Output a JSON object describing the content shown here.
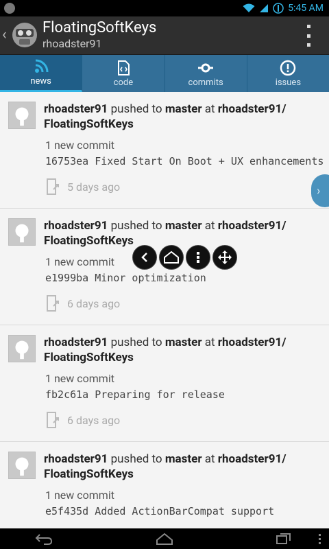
{
  "status_bar": {
    "time": "5:45 AM"
  },
  "action_bar": {
    "title": "FloatingSoftKeys",
    "subtitle": "rhoadster91"
  },
  "tabs": [
    {
      "label": "news",
      "icon": "rss-icon",
      "active": true
    },
    {
      "label": "code",
      "icon": "code-file-icon",
      "active": false
    },
    {
      "label": "commits",
      "icon": "commit-icon",
      "active": false
    },
    {
      "label": "issues",
      "icon": "issue-icon",
      "active": false
    }
  ],
  "feed": [
    {
      "user": "rhoadster91",
      "action": "pushed to",
      "branch": "master",
      "at": "at",
      "repo": "rhoadster91/",
      "repo2": "FloatingSoftKeys",
      "count": "1 new commit",
      "commit": "16753ea Fixed Start On Boot + UX enhancements",
      "time": "5 days ago"
    },
    {
      "user": "rhoadster91",
      "action": "pushed to",
      "branch": "master",
      "at": "at",
      "repo": "rhoadster91/",
      "repo2": "FloatingSoftKeys",
      "count": "1 new commit",
      "commit": "e1999ba Minor optimization",
      "time": "6 days ago"
    },
    {
      "user": "rhoadster91",
      "action": "pushed to",
      "branch": "master",
      "at": "at",
      "repo": "rhoadster91/",
      "repo2": "FloatingSoftKeys",
      "count": "1 new commit",
      "commit": "fb2c61a Preparing for release",
      "time": "6 days ago"
    },
    {
      "user": "rhoadster91",
      "action": "pushed to",
      "branch": "master",
      "at": "at",
      "repo": "rhoadster91/",
      "repo2": "FloatingSoftKeys",
      "count": "1 new commit",
      "commit": "e5f435d Added ActionBarCompat support",
      "time": ""
    }
  ],
  "colors": {
    "accent": "#33b5e5",
    "tab_bg": "#336f98",
    "actionbar_bg": "#2f2f2f"
  }
}
